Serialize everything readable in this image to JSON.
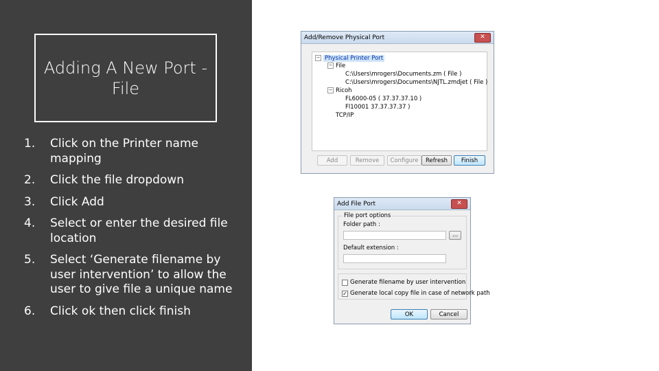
{
  "slide": {
    "title": "Adding A New Port - File",
    "steps": [
      {
        "num": "1.",
        "text": "Click on the Printer name mapping"
      },
      {
        "num": "2.",
        "text": "Click the file dropdown"
      },
      {
        "num": "3.",
        "text": "Click Add"
      },
      {
        "num": "4.",
        "text": "Select or enter the desired file location"
      },
      {
        "num": "5.",
        "text": "Select ‘Generate filename by user intervention’ to allow the user to give file a unique name"
      },
      {
        "num": "6.",
        "text": "Click ok then click finish"
      }
    ]
  },
  "port_dialog": {
    "title": "Add/Remove Physical Port",
    "close_glyph": "✕",
    "tree": {
      "root": "Physical Printer Port",
      "file_node": "File",
      "file_items": [
        "C:\\Users\\mrogers\\Documents.zm ( File )",
        "C:\\Users\\mrogers\\Documents\\NJTL.zmdjet ( File )"
      ],
      "ricoh_node": "Ricoh",
      "ricoh_items": [
        "FL6000-05 ( 37.37.37.10 )",
        "Fl10001 37.37.37.37 )"
      ],
      "tcpip_node": "TCP/IP"
    },
    "buttons": {
      "add": "Add",
      "remove": "Remove",
      "configure": "Configure",
      "refresh": "Refresh",
      "finish": "Finish"
    }
  },
  "file_dialog": {
    "title": "Add File Port",
    "close_glyph": "✕",
    "group_label": "File port options",
    "folder_label": "Folder path :",
    "browse": "...",
    "extension_label": "Default extension :",
    "folder_value": "",
    "extension_value": "",
    "gen_filename": {
      "label": "Generate filename by user intervention",
      "checked": false
    },
    "local_copy": {
      "label": "Generate local copy file in case of network path",
      "checked": true,
      "mark": "✓"
    },
    "ok": "OK",
    "cancel": "Cancel"
  }
}
